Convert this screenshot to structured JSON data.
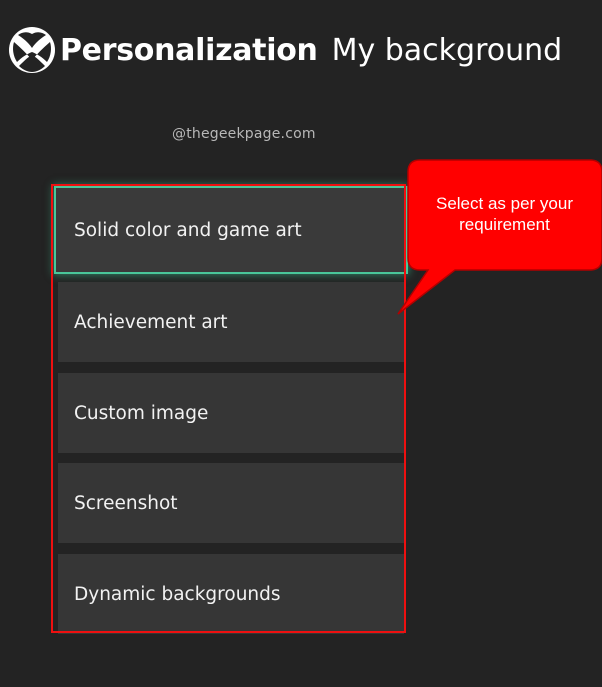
{
  "header": {
    "title": "Personalization",
    "subtitle": "My background",
    "logo_icon": "xbox-logo-icon"
  },
  "watermark": "@thegeekpage.com",
  "options": [
    {
      "label": "Solid color and game art",
      "focused": true
    },
    {
      "label": "Achievement art",
      "focused": false
    },
    {
      "label": "Custom image",
      "focused": false
    },
    {
      "label": "Screenshot",
      "focused": false
    },
    {
      "label": "Dynamic backgrounds",
      "focused": false
    }
  ],
  "callout": {
    "text_line1": "Select as per your",
    "text_line2": "requirement"
  },
  "colors": {
    "background": "#232323",
    "tile": "#363636",
    "focus_outline": "#49c79a",
    "annotation_red": "#ee1010"
  }
}
